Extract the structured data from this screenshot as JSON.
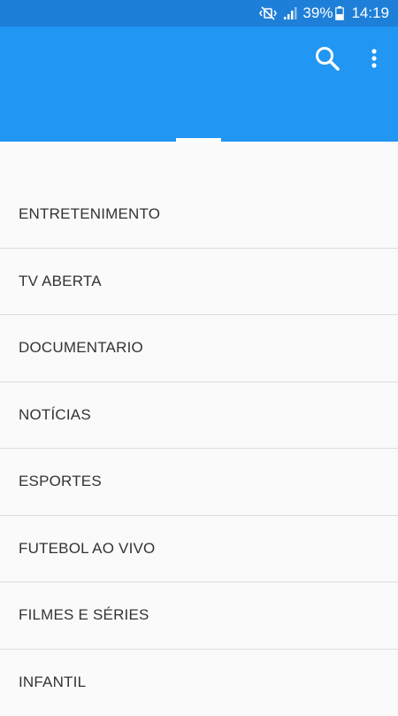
{
  "status_bar": {
    "battery_percent": "39%",
    "time": "14:19",
    "icons": [
      "mute-vibrate-icon",
      "signal-icon",
      "battery-icon"
    ]
  },
  "app_bar": {
    "title": "",
    "color": "#2196f3",
    "actions": [
      "search-icon",
      "more-vert-icon"
    ]
  },
  "categories": [
    "ENTRETENIMENTO",
    "TV ABERTA",
    "DOCUMENTARIO",
    "NOTÍCIAS",
    "ESPORTES",
    "FUTEBOL AO VIVO",
    "FILMES E SÉRIES",
    "INFANTIL"
  ]
}
